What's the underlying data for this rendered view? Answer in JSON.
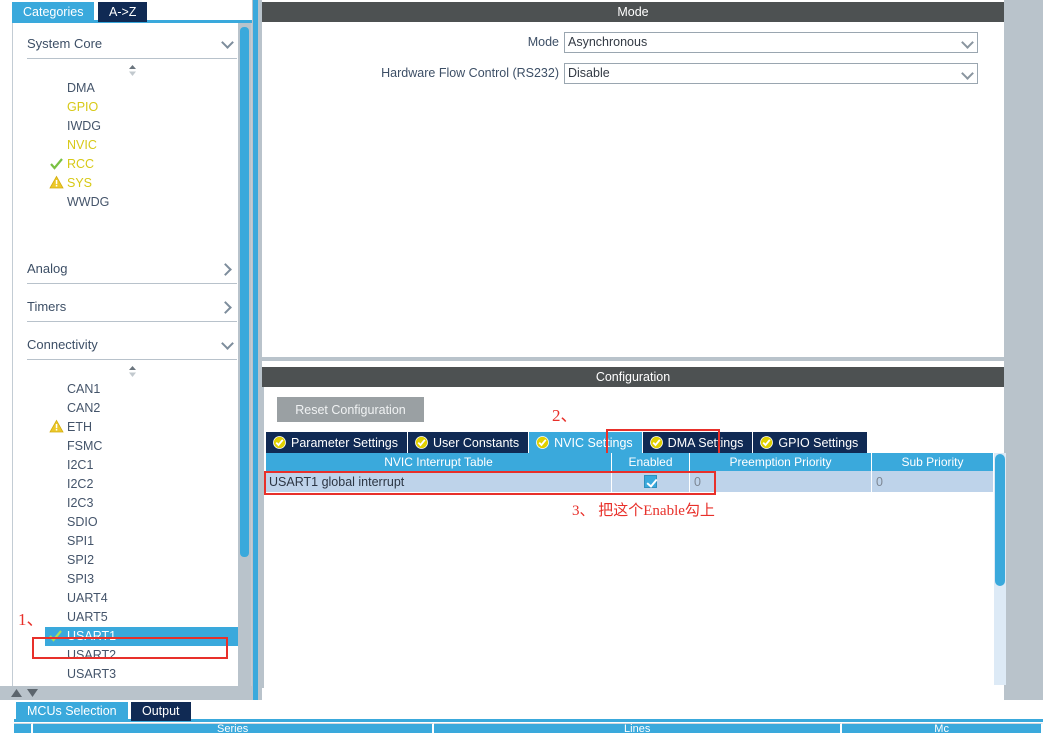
{
  "left_panel": {
    "tabs": [
      {
        "label": "Categories",
        "active": true
      },
      {
        "label": "A->Z",
        "active": false
      }
    ],
    "groups": [
      {
        "name": "System Core",
        "expanded": true,
        "items": [
          {
            "label": "DMA",
            "status": "none",
            "selected": false
          },
          {
            "label": "GPIO",
            "status": "enabled-name",
            "selected": false
          },
          {
            "label": "IWDG",
            "status": "none",
            "selected": false
          },
          {
            "label": "NVIC",
            "status": "enabled-name",
            "selected": false
          },
          {
            "label": "RCC",
            "status": "check",
            "selected": false
          },
          {
            "label": "SYS",
            "status": "warning",
            "selected": false
          },
          {
            "label": "WWDG",
            "status": "none",
            "selected": false
          }
        ]
      },
      {
        "name": "Analog",
        "expanded": false,
        "items": []
      },
      {
        "name": "Timers",
        "expanded": false,
        "items": []
      },
      {
        "name": "Connectivity",
        "expanded": true,
        "items": [
          {
            "label": "CAN1",
            "status": "none",
            "selected": false
          },
          {
            "label": "CAN2",
            "status": "none",
            "selected": false
          },
          {
            "label": "ETH",
            "status": "warning",
            "selected": false
          },
          {
            "label": "FSMC",
            "status": "none",
            "selected": false
          },
          {
            "label": "I2C1",
            "status": "none",
            "selected": false
          },
          {
            "label": "I2C2",
            "status": "none",
            "selected": false
          },
          {
            "label": "I2C3",
            "status": "none",
            "selected": false
          },
          {
            "label": "SDIO",
            "status": "none",
            "selected": false
          },
          {
            "label": "SPI1",
            "status": "none",
            "selected": false
          },
          {
            "label": "SPI2",
            "status": "none",
            "selected": false
          },
          {
            "label": "SPI3",
            "status": "none",
            "selected": false
          },
          {
            "label": "UART4",
            "status": "none",
            "selected": false
          },
          {
            "label": "UART5",
            "status": "none",
            "selected": false
          },
          {
            "label": "USART1",
            "status": "check",
            "selected": true
          },
          {
            "label": "USART2",
            "status": "none",
            "selected": false
          },
          {
            "label": "USART3",
            "status": "none",
            "selected": false
          }
        ]
      }
    ]
  },
  "mode_panel": {
    "title": "Mode",
    "fields": [
      {
        "label": "Mode",
        "value": "Asynchronous"
      },
      {
        "label": "Hardware Flow Control (RS232)",
        "value": "Disable"
      }
    ]
  },
  "config_panel": {
    "title": "Configuration",
    "reset_label": "Reset Configuration",
    "tabs": [
      {
        "label": "Parameter Settings",
        "active": false
      },
      {
        "label": "User Constants",
        "active": false
      },
      {
        "label": "NVIC Settings",
        "active": true
      },
      {
        "label": "DMA Settings",
        "active": false
      },
      {
        "label": "GPIO Settings",
        "active": false
      }
    ],
    "nvic_table": {
      "columns": [
        "NVIC Interrupt Table",
        "Enabled",
        "Preemption Priority",
        "Sub Priority"
      ],
      "rows": [
        {
          "interrupt": "USART1 global interrupt",
          "enabled": true,
          "preemption_priority": "0",
          "sub_priority": "0"
        }
      ]
    }
  },
  "annotations": {
    "step1": "1、",
    "step2": "2、",
    "step3": "3、  把这个Enable勾上"
  },
  "bottom": {
    "tabs": [
      {
        "label": "MCUs Selection",
        "active": true
      },
      {
        "label": "Output",
        "active": false
      }
    ],
    "table_columns": [
      "",
      "Series",
      "Lines",
      "Mc"
    ]
  },
  "colors": {
    "accent_blue": "#3aa9dc",
    "tab_navy": "#102a54",
    "annotation_red": "#e8302a",
    "warning_yellow": "#ecc82a",
    "check_green": "#7ac143",
    "panel_gray": "#b9c3cb",
    "title_bar": "#4d5152"
  }
}
